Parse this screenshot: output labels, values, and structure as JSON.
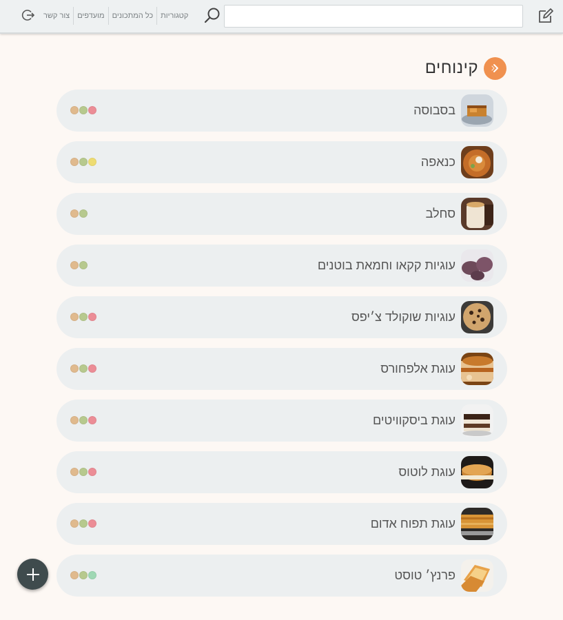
{
  "header": {
    "search": {
      "value": "",
      "placeholder": ""
    },
    "nav": [
      {
        "label": "קטגוריות"
      },
      {
        "label": "כל המתכונים"
      },
      {
        "label": "מועדפים"
      },
      {
        "label": "צור קשר"
      }
    ]
  },
  "page": {
    "title": "קינוחים"
  },
  "recipes": [
    {
      "name": "בסבוסה",
      "image": "basbousa",
      "dots": [
        "#e0ba8e",
        "#b7c98e",
        "#ec8d96"
      ]
    },
    {
      "name": "כנאפה",
      "image": "knafeh",
      "dots": [
        "#e0ba8e",
        "#b7c98e",
        "#eedc72"
      ]
    },
    {
      "name": "סחלב",
      "image": "sahlab",
      "dots": [
        "#e0ba8e",
        "#b7c98e"
      ]
    },
    {
      "name": "עוגיות קקאו וחמאת בוטנים",
      "image": "cocoa-cookies",
      "dots": [
        "#e0ba8e",
        "#b7c98e"
      ]
    },
    {
      "name": "עוגיות שוקולד צ׳יפס",
      "image": "chocolate-chip-cookies",
      "dots": [
        "#e0ba8e",
        "#b7c98e",
        "#ec8d96"
      ]
    },
    {
      "name": "עוגת אלפחורס",
      "image": "alfajores-cake",
      "dots": [
        "#e0ba8e",
        "#b7c98e",
        "#ec8d96"
      ]
    },
    {
      "name": "עוגת ביסקוויטים",
      "image": "biscuit-cake",
      "dots": [
        "#e0ba8e",
        "#b7c98e",
        "#ec8d96"
      ]
    },
    {
      "name": "עוגת לוטוס",
      "image": "lotus-cake",
      "dots": [
        "#e0ba8e",
        "#b7c98e",
        "#ec8d96"
      ]
    },
    {
      "name": "עוגת תפוח אדום",
      "image": "red-apple-cake",
      "dots": [
        "#e0ba8e",
        "#b7c98e",
        "#ec8d96"
      ]
    },
    {
      "name": "פרנץ׳ טוסט",
      "image": "french-toast",
      "dots": [
        "#e0ba8e",
        "#b7c98e",
        "#9fd8b4"
      ]
    }
  ],
  "theme": {
    "accent": "#f0914f",
    "fab": "#3f4b4d",
    "row_bg": "#eceff0"
  }
}
